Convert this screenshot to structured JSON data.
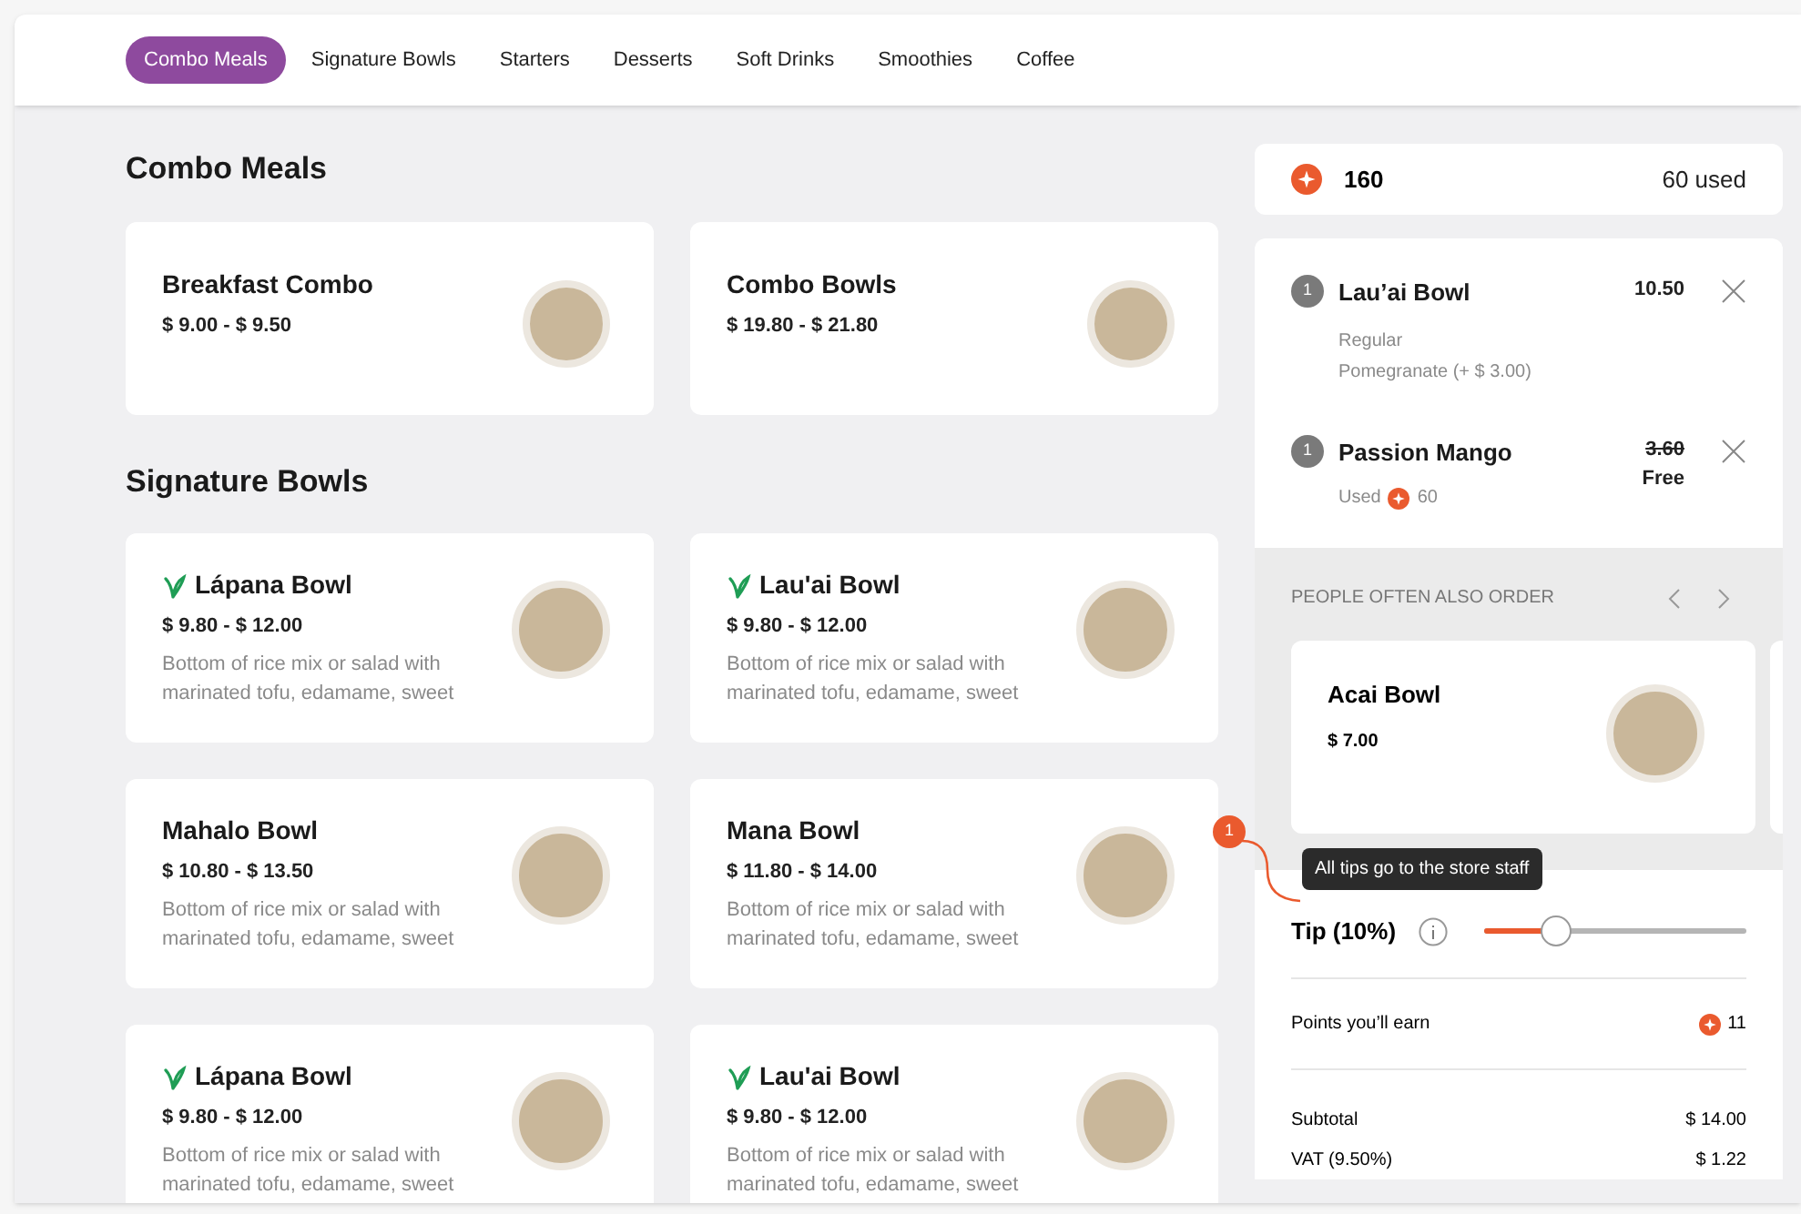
{
  "tabs": [
    {
      "label": "Combo Meals",
      "selected": true
    },
    {
      "label": "Signature Bowls",
      "selected": false
    },
    {
      "label": "Starters",
      "selected": false
    },
    {
      "label": "Desserts",
      "selected": false
    },
    {
      "label": "Soft Drinks",
      "selected": false
    },
    {
      "label": "Smoothies",
      "selected": false
    },
    {
      "label": "Coffee",
      "selected": false
    }
  ],
  "sections": [
    {
      "title": "Combo Meals",
      "items": [
        {
          "name": "Breakfast Combo",
          "price": "$ 9.00 - $ 9.50",
          "vegan": false
        },
        {
          "name": "Combo Bowls",
          "price": "$ 19.80 - $ 21.80",
          "vegan": false
        }
      ]
    },
    {
      "title": "Signature Bowls",
      "items": [
        {
          "name": "Lápana Bowl",
          "price": "$ 9.80 - $ 12.00",
          "description": "Bottom of rice mix or salad with marinated tofu, edamame, sweet",
          "vegan": true
        },
        {
          "name": "Lau'ai Bowl",
          "price": "$ 9.80 - $ 12.00",
          "description": "Bottom of rice mix or salad with marinated tofu, edamame, sweet",
          "vegan": true
        },
        {
          "name": "Mahalo Bowl",
          "price": "$ 10.80 - $ 13.50",
          "description": "Bottom of rice mix or salad with marinated tofu, edamame, sweet",
          "vegan": false
        },
        {
          "name": "Mana Bowl",
          "price": "$ 11.80 - $ 14.00",
          "description": "Bottom of rice mix or salad with marinated tofu, edamame, sweet",
          "vegan": false
        },
        {
          "name": "Lápana Bowl",
          "price": "$ 9.80 - $ 12.00",
          "description": "Bottom of rice mix or salad with marinated tofu, edamame, sweet",
          "vegan": true
        },
        {
          "name": "Lau'ai Bowl",
          "price": "$ 9.80 - $ 12.00",
          "description": "Bottom of rice mix or salad with marinated tofu, edamame, sweet",
          "vegan": true
        }
      ]
    }
  ],
  "points": {
    "balance": "160",
    "used": "60 used"
  },
  "cart": [
    {
      "kind": "regular",
      "qty": "1",
      "name": "Lau’ai Bowl",
      "price": "10.50",
      "options": [
        "Regular",
        "Pomegranate (+ $ 3.00)"
      ]
    },
    {
      "kind": "reward",
      "qty": "1",
      "name": "Passion Mango",
      "old_price": "3.60",
      "price": "Free",
      "used_label": "Used",
      "used_points": "60"
    }
  ],
  "suggestions": {
    "title": "PEOPLE OFTEN ALSO ORDER",
    "items": [
      {
        "name": "Acai Bowl",
        "price": "$ 7.00"
      }
    ]
  },
  "annotation": {
    "number": "1"
  },
  "tip": {
    "label": "Tip (10%)",
    "tooltip": "All tips go to the store staff",
    "level": 0.27
  },
  "points_earned": {
    "label": "Points you’ll earn",
    "value": "11"
  },
  "totals": [
    {
      "label": "Subtotal",
      "value": "$ 14.00"
    },
    {
      "label": "VAT (9.50%)",
      "value": "$ 1.22"
    }
  ]
}
